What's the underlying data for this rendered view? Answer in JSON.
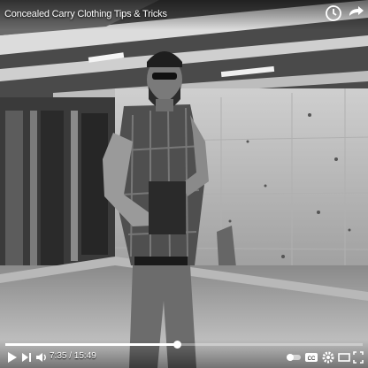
{
  "video": {
    "title": "Concealed Carry Clothing Tips & Tricks",
    "time_display": "7:35 / 15:49",
    "progress_fraction": 0.48
  },
  "icons": {
    "top": [
      "clock-icon",
      "share-icon"
    ],
    "left_controls": [
      "play-icon",
      "next-icon",
      "volume-icon"
    ],
    "right_controls": [
      "autoplay-toggle-icon",
      "captions-icon",
      "settings-icon",
      "theater-mode-icon",
      "fullscreen-icon"
    ]
  }
}
